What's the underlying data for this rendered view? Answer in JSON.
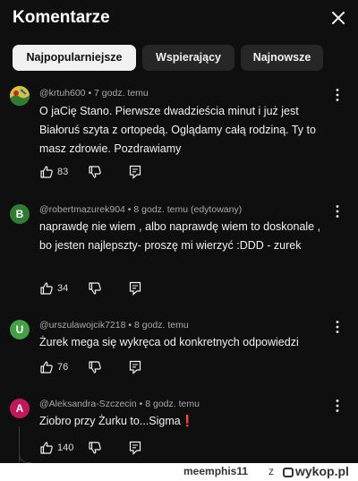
{
  "header": {
    "title": "Komentarze",
    "close_icon": "close-icon"
  },
  "chips": [
    "Najpopularniejsze",
    "Wspierający",
    "Najnowsze"
  ],
  "comments": [
    {
      "author": "@krtuh600",
      "time": "7 godz. temu",
      "text": "O jaCię Stano. Pierwsze dwadzieścia minut i już jest Białoruś szyta z ortopedą. Oglądamy całą rodziną. Ty to masz zdrowie. Pozdrawiamy",
      "likes": "83",
      "avatar_letter": "",
      "avatar_color": "#3a8f3a"
    },
    {
      "author": "@robertmazurek904",
      "time": "8 godz. temu (edytowany)",
      "text": "naprawdę nie wiem , albo naprawdę wiem to doskonale , bo jesten najlepszty- proszę mi wierzyć :DDD  - zurek",
      "likes": "34",
      "avatar_letter": "B",
      "avatar_color": "#2e7d32"
    },
    {
      "author": "@urszulawojcik7218",
      "time": "8 godz. temu",
      "text": "Żurek mega się wykręca od konkretnych odpowiedzi",
      "likes": "76",
      "avatar_letter": "U",
      "avatar_color": "#43a047"
    },
    {
      "author": "@Aleksandra-Szczecin",
      "time": "8 godz. temu",
      "text": "Ziobro przy Żurku to...Sigma❗",
      "likes": "140",
      "avatar_letter": "A",
      "avatar_color": "#c2185b"
    }
  ],
  "footer": {
    "user": "meemphis11",
    "z": "z",
    "brand": "wykop.pl"
  },
  "colors": {
    "background": "#0f0f0f",
    "chip_active": "#f1f1f1",
    "chip": "#272727",
    "meta": "#aaaaaa"
  }
}
